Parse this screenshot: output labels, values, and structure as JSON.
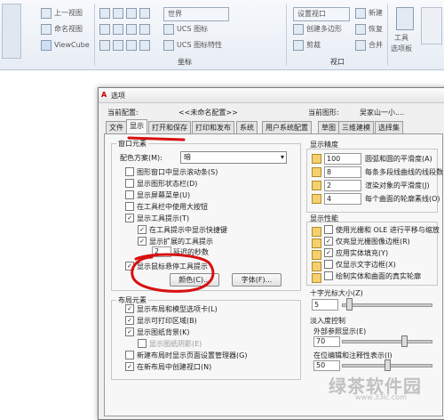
{
  "ribbon": {
    "items": {
      "top_view": "上一视图",
      "named_view": "命名视图",
      "viewcube": "ViewCube",
      "world": "世界",
      "ucs_icon": "UCS 图标",
      "ucs_icon_props": "UCS 图标特性",
      "settings_viewport": "设置视口",
      "create_poly": "创建多边形",
      "clip": "剪裁",
      "new": "新建",
      "restore": "恢复",
      "merge": "合并",
      "tool": "工具",
      "palette": "选项板"
    },
    "panels": {
      "coords": "坐标",
      "viewport": "视口"
    }
  },
  "dialog": {
    "title": "选项",
    "current_profile_label": "当前配置:",
    "current_profile_value": "<<未命名配置>>",
    "current_drawing_label": "当前图形:",
    "current_drawing_value": "吴家山一小....",
    "tabs": [
      "文件",
      "显示",
      "打开和保存",
      "打印和发布",
      "系统",
      "用户系统配置",
      "草图",
      "三维建模",
      "选择集"
    ],
    "window_elements": {
      "title": "窗口元素",
      "color_scheme_label": "配色方案(M):",
      "color_scheme_value": "暗",
      "options": [
        {
          "label": "图形窗口中显示滚动条(S)",
          "checked": false
        },
        {
          "label": "显示图形状态栏(D)",
          "checked": false
        },
        {
          "label": "显示屏幕菜单(U)",
          "checked": false
        },
        {
          "label": "在工具栏中使用大按钮",
          "checked": false
        },
        {
          "label": "显示工具提示(T)",
          "checked": true
        },
        {
          "label": "在工具提示中显示快捷键",
          "checked": true
        },
        {
          "label": "显示扩展的工具提示",
          "checked": true
        },
        {
          "label": "延迟的秒数",
          "checked": false
        },
        {
          "label": "显示鼠标悬停工具提示",
          "checked": true
        }
      ],
      "delay_value": "2",
      "color_button": "颜色(C)...",
      "font_button": "字体(F)..."
    },
    "layout_elements": {
      "title": "布局元素",
      "options": [
        {
          "label": "显示布局和模型选项卡(L)",
          "checked": true
        },
        {
          "label": "显示可打印区域(B)",
          "checked": true
        },
        {
          "label": "显示图纸背景(K)",
          "checked": true
        },
        {
          "label": "显示图纸阴影(E)",
          "checked": false
        },
        {
          "label": "新建布局时显示页面设置管理器(G)",
          "checked": false
        },
        {
          "label": "在新布局中创建视口(N)",
          "checked": true
        }
      ]
    },
    "display_resolution": {
      "title": "显示精度",
      "items": [
        {
          "value": "100",
          "label": "圆弧和圆的平滑度(A)"
        },
        {
          "value": "8",
          "label": "每条多段线曲线的线段数"
        },
        {
          "value": "2",
          "label": "渲染对象的平滑度(J)"
        },
        {
          "value": "4",
          "label": "每个曲面的轮廓素线(O)"
        }
      ]
    },
    "display_performance": {
      "title": "显示性能",
      "options": [
        {
          "label": "使用光栅和 OLE 进行平移与缩放",
          "checked": false
        },
        {
          "label": "仅亮显光栅图像边框(R)",
          "checked": true
        },
        {
          "label": "应用实体填充(Y)",
          "checked": true
        },
        {
          "label": "仅显示文字边框(X)",
          "checked": false
        },
        {
          "label": "绘制实体和曲面的真实轮廓",
          "checked": false
        }
      ]
    },
    "crosshair": {
      "title": "十字光标大小(Z)",
      "value": "5",
      "level_fraction": 0.05
    },
    "fade": {
      "title": "淡入度控制",
      "xref_label": "外部参照显示(E)",
      "xref_value": "70",
      "xref_fraction": 0.7,
      "inplace_label": "在位编辑和注释性表示(I)",
      "inplace_value": "50",
      "inplace_fraction": 0.5
    }
  },
  "watermark": {
    "text": "绿茶软件园",
    "sub": "www.33lc.com"
  },
  "annotation_color": "#d81010"
}
